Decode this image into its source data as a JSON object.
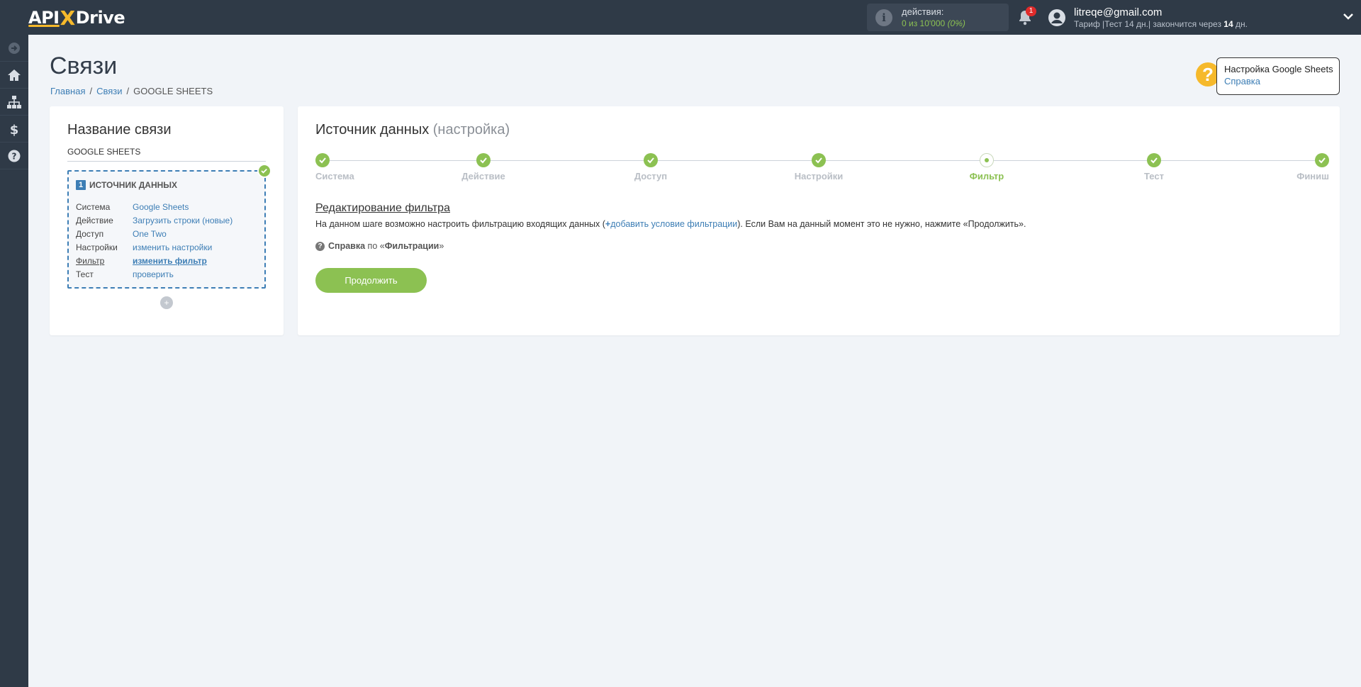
{
  "brand": {
    "logo_left": "API",
    "logo_x": "X",
    "logo_right": "Drive",
    "accent": "#f6b92b",
    "topbar_bg": "#2f3a47"
  },
  "topbar": {
    "actions_label": "действия:",
    "actions_value": "0 из 10'000",
    "actions_percent": "(0%)",
    "notifications_count": "1",
    "user_email": "litreqe@gmail.com",
    "plan_prefix": "Тариф |Тест 14 дн.| закончится через",
    "plan_days": "14",
    "plan_suffix": "дн."
  },
  "sidebar": {
    "items": [
      {
        "icon": "arrow-right-circle-icon"
      },
      {
        "icon": "home-icon"
      },
      {
        "icon": "sitemap-icon"
      },
      {
        "icon": "dollar-icon"
      },
      {
        "icon": "question-circle-icon"
      }
    ]
  },
  "page": {
    "title": "Связи",
    "breadcrumb": [
      "Главная",
      "Связи",
      "GOOGLE SHEETS"
    ]
  },
  "help_panel": {
    "title": "Настройка Google Sheets",
    "link": "Справка"
  },
  "connection": {
    "title": "Название связи",
    "name": "GOOGLE SHEETS",
    "source": {
      "number": "1",
      "heading": "ИСТОЧНИК ДАННЫХ",
      "rows": [
        {
          "key": "Система",
          "value": "Google Sheets"
        },
        {
          "key": "Действие",
          "value": "Загрузить строки (новые)"
        },
        {
          "key": "Доступ",
          "value": "One Two"
        },
        {
          "key": "Настройки",
          "value": "изменить настройки"
        },
        {
          "key": "Фильтр",
          "value": "изменить фильтр"
        },
        {
          "key": "Тест",
          "value": "проверить"
        }
      ]
    }
  },
  "main": {
    "title": "Источник данных",
    "title_sub": "(настройка)",
    "steps": [
      {
        "label": "Система",
        "state": "done"
      },
      {
        "label": "Действие",
        "state": "done"
      },
      {
        "label": "Доступ",
        "state": "done"
      },
      {
        "label": "Настройки",
        "state": "done"
      },
      {
        "label": "Фильтр",
        "state": "current"
      },
      {
        "label": "Тест",
        "state": "done"
      },
      {
        "label": "Финиш",
        "state": "done"
      }
    ],
    "filter_title": "Редактирование фильтра",
    "filter_desc_before": "На данном шаге возможно настроить фильтрацию входящих данных (",
    "filter_desc_link": "добавить условие фильтрации",
    "filter_desc_after": "). Если Вам на данный момент это не нужно, нажмите «Продолжить».",
    "help_label": "Справка",
    "help_middle": "по «",
    "help_topic": "Фильтрации",
    "help_end": "»",
    "continue_label": "Продолжить",
    "accent_green": "#8cc152"
  }
}
